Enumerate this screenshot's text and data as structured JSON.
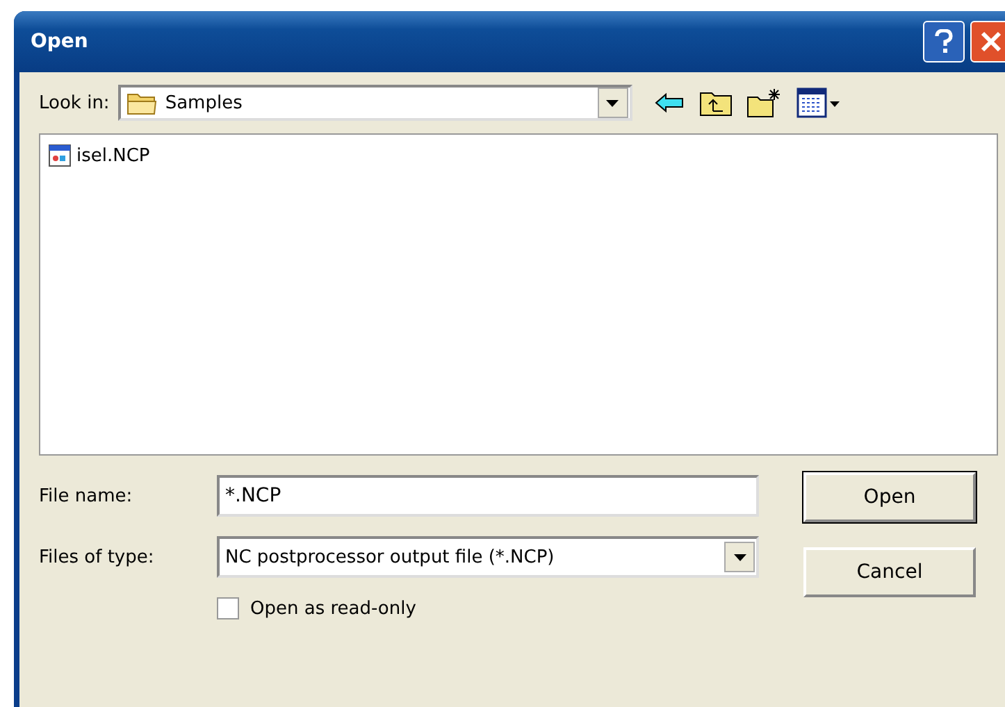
{
  "window": {
    "title": "Open"
  },
  "look_in": {
    "label": "Look in:",
    "value": "Samples"
  },
  "files": [
    {
      "name": "isel.NCP",
      "selected": false
    }
  ],
  "file_name": {
    "label": "File name:",
    "value": "*.NCP"
  },
  "files_of_type": {
    "label": "Files of type:",
    "value": "NC postprocessor output file (*.NCP)"
  },
  "buttons": [
    {
      "label": "Open",
      "default": true
    },
    {
      "label": "Cancel",
      "default": false
    }
  ],
  "read_only": {
    "label": "Open as read-only",
    "checked": false
  }
}
